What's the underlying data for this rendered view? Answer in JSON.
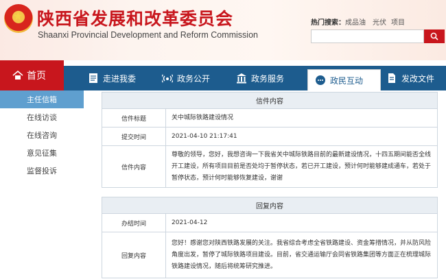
{
  "header": {
    "title": "陕西省发展和改革委员会",
    "subtitle": "Shaanxi Provincial Development and Reform Commission",
    "hot_search_label": "热门搜索：",
    "hot_search_terms": [
      "成品油",
      "光伏",
      "项目"
    ],
    "search_placeholder": ""
  },
  "nav": {
    "home": "首页",
    "items": [
      "走进我委",
      "政务公开",
      "政务服务",
      "政民互动",
      "发改文件"
    ],
    "active_index": 3
  },
  "sidebar": {
    "items": [
      "主任信箱",
      "在线访谈",
      "在线咨询",
      "意见征集",
      "监督投诉"
    ],
    "active_index": 0
  },
  "letter": {
    "section_title": "信件内容",
    "title_label": "信件标题",
    "title_value": "关中城际铁路建设情况",
    "time_label": "提交时间",
    "time_value": "2021-04-10 21:17:41",
    "content_label": "信件内容",
    "content_value": "尊敬的领导，您好，我想咨询一下我省关中城际铁路目前的最新建设情况，十四五期间能否全线开工建设，所有项目目前是否处均于暂停状态，若已开工建设，预计何时能够建成通车，若处于暂停状态，预计何时能够恢复建设，谢谢"
  },
  "reply": {
    "section_title": "回复内容",
    "date_label": "办结时间",
    "date_value": "2021-04-12",
    "content_label": "回复内容",
    "content_value": "您好！感谢您对陕西铁路发展的关注。我省综合考虑全省铁路建设、资金筹措情况，并从防风险角度出发，暂停了城际铁路项目建设。目前，省交通运输厅会同省铁路集团等方面正在梳理城际铁路建设情况，随后将统筹研究推进。"
  },
  "colors": {
    "brand_red": "#c8161d",
    "nav_blue": "#1d5c8e",
    "sidebar_active": "#5f9fcf"
  }
}
